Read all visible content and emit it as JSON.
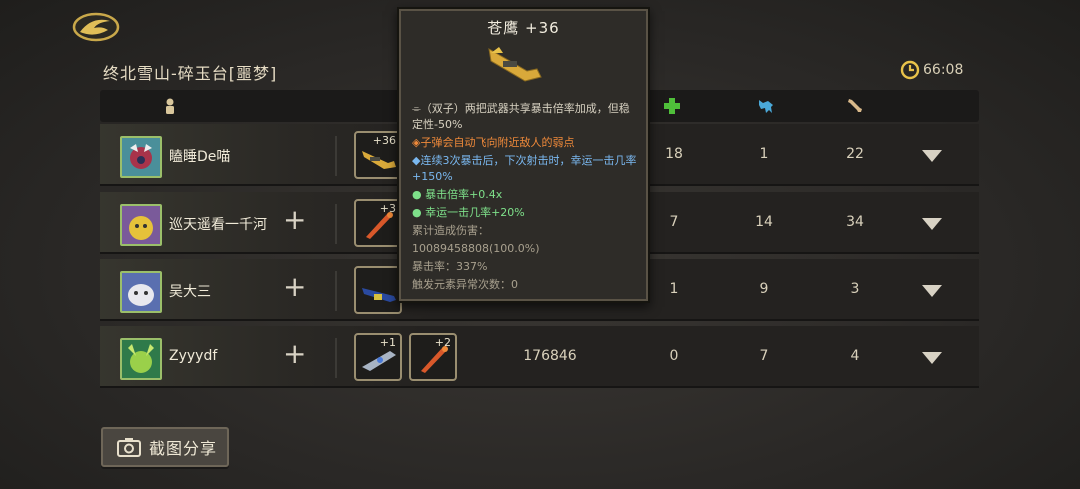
{
  "stage_title": "终北雪山-碎玉台[噩梦]",
  "timer": "66:08",
  "header_icons": [
    "player-icon",
    "heal-cross-icon",
    "wolf-icon",
    "bone-icon"
  ],
  "players": [
    {
      "name": "瞌睡De喵",
      "weapons": [
        {
          "level": "+36",
          "icon": "golden-crossbow"
        }
      ],
      "damage": "",
      "heal": "18",
      "col2": "1",
      "col3": "22",
      "show_plus": false
    },
    {
      "name": "巡天遥看一千河",
      "weapons": [
        {
          "level": "+3",
          "icon": "orange-staff"
        }
      ],
      "damage": "",
      "heal": "7",
      "col2": "14",
      "col3": "34",
      "show_plus": true
    },
    {
      "name": "吴大三",
      "weapons": [
        {
          "level": "",
          "icon": "blue-rifle"
        }
      ],
      "damage": "",
      "heal": "1",
      "col2": "9",
      "col3": "3",
      "show_plus": true
    },
    {
      "name": "Zyyydf",
      "weapons": [
        {
          "level": "+1",
          "icon": "silver-gun"
        },
        {
          "level": "+2",
          "icon": "orange-staff"
        }
      ],
      "damage": "176846",
      "heal": "0",
      "col2": "7",
      "col3": "4",
      "show_plus": true
    }
  ],
  "tooltip": {
    "title": "苍鹰 +36",
    "line1": "⌯（双子）两把武器共享暴击倍率加成，但稳定性-50%",
    "line2": "◈子弹会自动飞向附近敌人的弱点",
    "line3": "◆连续3次暴击后，下次射击时，幸运一击几率+150%",
    "line4": "● 暴击倍率+0.4x",
    "line5": "● 幸运一击几率+20%",
    "line6": "累计造成伤害：",
    "line7": "10089458808(100.0%)",
    "line8": "暴击率：337%",
    "line9": "触发元素异常次数：0"
  },
  "share_button": "截图分享",
  "colors": {
    "accent_gold": "#e8c24a",
    "heal_green": "#4fbf3a",
    "wolf_blue": "#4aa8d8"
  }
}
